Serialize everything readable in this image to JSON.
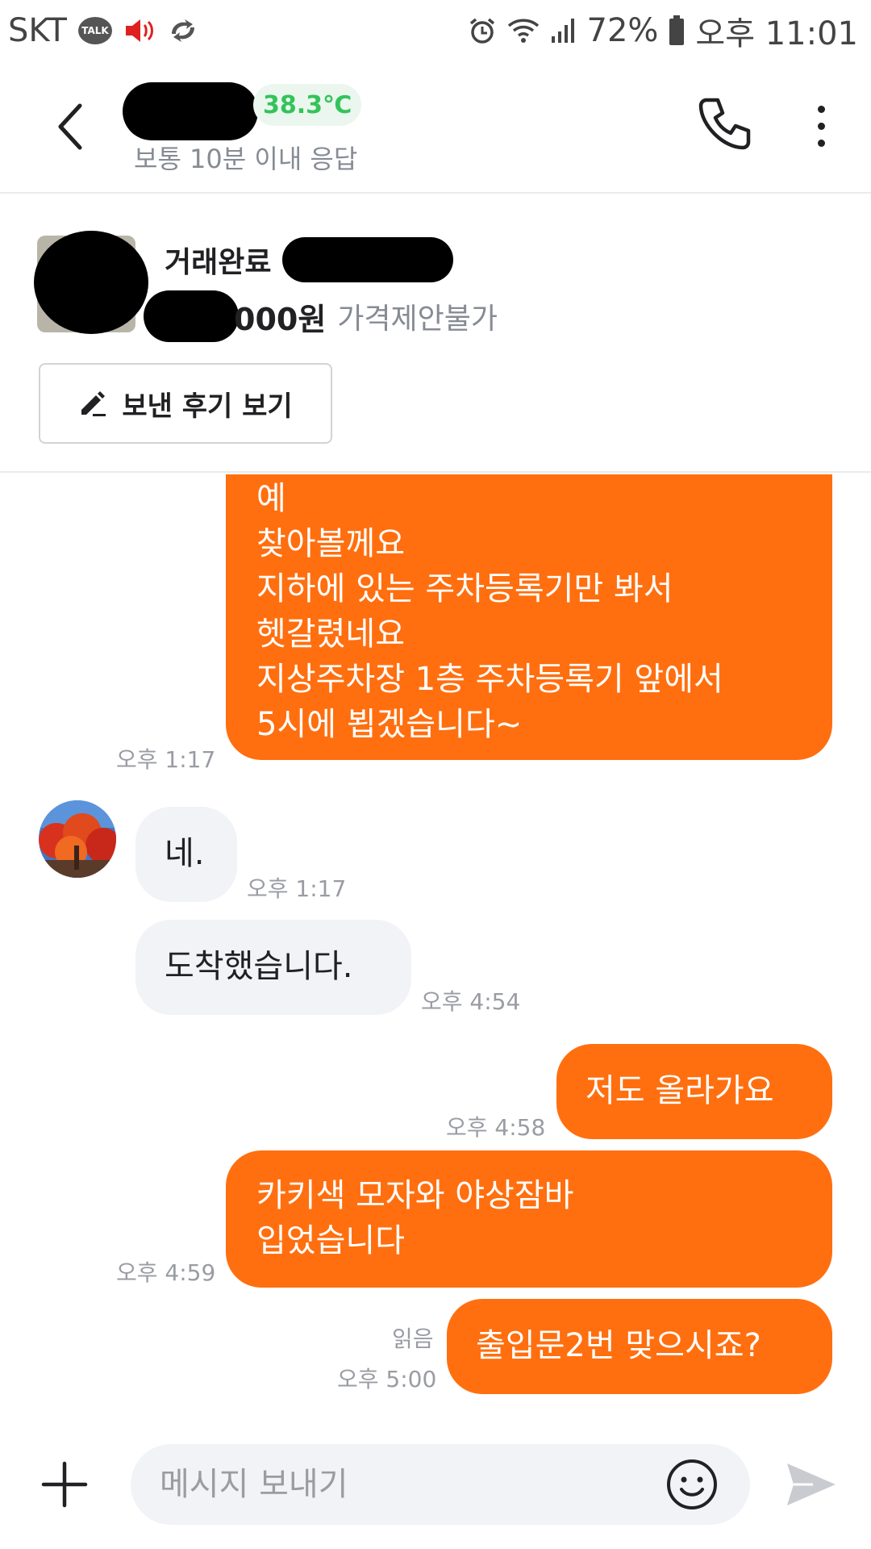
{
  "status_bar": {
    "carrier": "SKT",
    "talk_label": "TALK",
    "battery": "72%",
    "time": "오후 11:01"
  },
  "header": {
    "temperature": "38.3℃",
    "response_time": "보통 10분 이내 응답"
  },
  "product": {
    "status": "거래완료",
    "price_suffix": "000원",
    "price_note": "가격제안불가",
    "review_button": "보낸 후기 보기"
  },
  "messages": [
    {
      "side": "me",
      "text": "예\n찾아볼께요\n지하에 있는 주차등록기만 봐서\n헷갈렸네요\n지상주차장 1층 주차등록기 앞에서\n5시에 뵙겠습니다~",
      "time": "오후 1:17"
    },
    {
      "side": "them",
      "text": "네.",
      "time": "오후 1:17"
    },
    {
      "side": "them",
      "text": "도착했습니다.",
      "time": "오후 4:54"
    },
    {
      "side": "me",
      "text": "저도 올라가요",
      "time": "오후 4:58"
    },
    {
      "side": "me",
      "text": "카키색 모자와 야상잠바\n입었습니다",
      "time": "오후 4:59"
    },
    {
      "side": "me",
      "text": "출입문2번 맞으시죠?",
      "time": "오후 5:00",
      "read": "읽음"
    }
  ],
  "input": {
    "placeholder": "메시지 보내기"
  },
  "colors": {
    "accent": "#ff6f0f",
    "temperature": "#33c35a",
    "bubble_them": "#f2f3f6"
  }
}
